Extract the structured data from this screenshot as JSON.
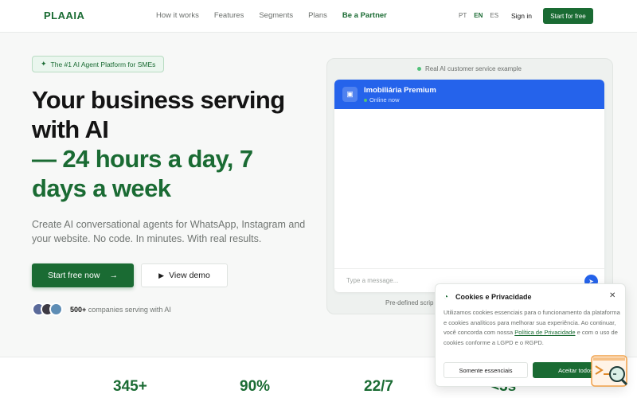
{
  "header": {
    "logo": "PLAAIA",
    "links": [
      "How it works",
      "Features",
      "Segments",
      "Plans"
    ],
    "partner": "Be a Partner",
    "langs": [
      "PT",
      "EN",
      "ES"
    ],
    "active_lang": "EN",
    "signin": "Sign in",
    "start": "Start for free"
  },
  "hero": {
    "badge": "The #1 AI Agent Platform for SMEs",
    "title_line1": "Your business serving",
    "title_line2": "with AI",
    "title_green1": "— 24 hours a day, 7",
    "title_green2": "days a week",
    "subtitle": "Create AI conversational agents for WhatsApp, Instagram and your website. No code. In minutes. With real results.",
    "cta_primary": "Start free now",
    "cta_secondary": "View demo",
    "social_count": "500+",
    "social_text": "companies serving with AI"
  },
  "demo": {
    "example_label": "Real AI customer service example",
    "bot_name": "Imobiliária Premium",
    "bot_status": "Online now",
    "input_placeholder": "Type a message...",
    "footer_note": "Pre-defined scrip"
  },
  "stats": [
    "345+",
    "90%",
    "22/7",
    "<3s"
  ],
  "cookie": {
    "title": "Cookies e Privacidade",
    "text_before": "Utilizamos cookies essenciais para o funcionamento da plataforma e cookies analíticos para melhorar sua experiência. Ao continuar, você concorda com nossa ",
    "link": "Política de Privacidade",
    "text_after": " e com o uso de cookies conforme a LGPD e o RGPD.",
    "btn_essential": "Somente essenciais",
    "btn_accept": "Aceitar todos"
  },
  "colors": {
    "brand_green": "#1a6b33",
    "chat_blue": "#2563eb",
    "online_dot": "#52c27a"
  }
}
